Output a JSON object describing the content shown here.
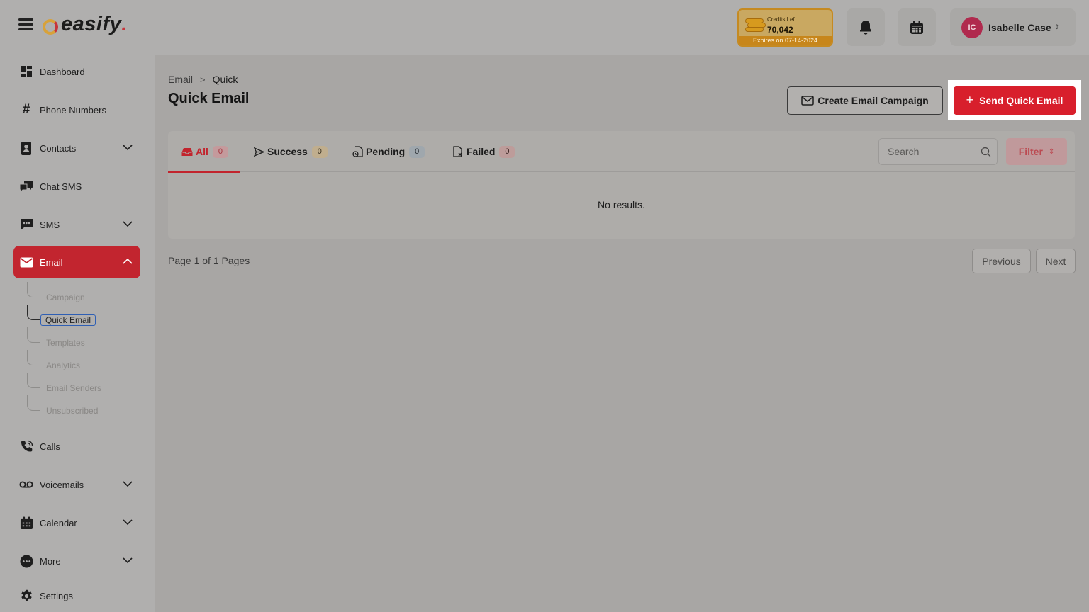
{
  "app": {
    "logo_text": "easify",
    "logo_dot": "."
  },
  "colors": {
    "brand_red": "#d81f2c",
    "gold": "#c58a22"
  },
  "credits": {
    "label": "Credits Left",
    "value": "70,042",
    "expires": "Expires on 07-14-2024"
  },
  "user": {
    "initials": "IC",
    "name": "Isabelle Case"
  },
  "sidebar": {
    "items": [
      {
        "label": "Dashboard",
        "icon": "dashboard-icon"
      },
      {
        "label": "Phone Numbers",
        "icon": "hash-icon"
      },
      {
        "label": "Contacts",
        "icon": "contacts-icon"
      },
      {
        "label": "Chat SMS",
        "icon": "chat-icon"
      },
      {
        "label": "SMS",
        "icon": "sms-icon"
      },
      {
        "label": "Email",
        "icon": "mail-icon"
      },
      {
        "label": "Calls",
        "icon": "phone-icon"
      },
      {
        "label": "Voicemails",
        "icon": "voicemail-icon"
      },
      {
        "label": "Calendar",
        "icon": "calendar-icon"
      },
      {
        "label": "More",
        "icon": "more-icon"
      },
      {
        "label": "Settings",
        "icon": "gear-icon"
      }
    ],
    "email_sub": [
      "Campaign",
      "Quick Email",
      "Templates",
      "Analytics",
      "Email Senders",
      "Unsubscribed"
    ]
  },
  "breadcrumb": {
    "parent": "Email",
    "separator": ">",
    "current": "Quick"
  },
  "page": {
    "title": "Quick Email"
  },
  "actions": {
    "create_campaign": "Create Email Campaign",
    "send_quick": "Send Quick Email",
    "send_plus": "+"
  },
  "tabs": [
    {
      "label": "All",
      "count": "0"
    },
    {
      "label": "Success",
      "count": "0"
    },
    {
      "label": "Pending",
      "count": "0"
    },
    {
      "label": "Failed",
      "count": "0"
    }
  ],
  "search": {
    "placeholder": "Search"
  },
  "filter": {
    "label": "Filter"
  },
  "table": {
    "empty_text": "No results."
  },
  "pagination": {
    "text": "Page 1 of 1 Pages",
    "previous": "Previous",
    "next": "Next"
  }
}
